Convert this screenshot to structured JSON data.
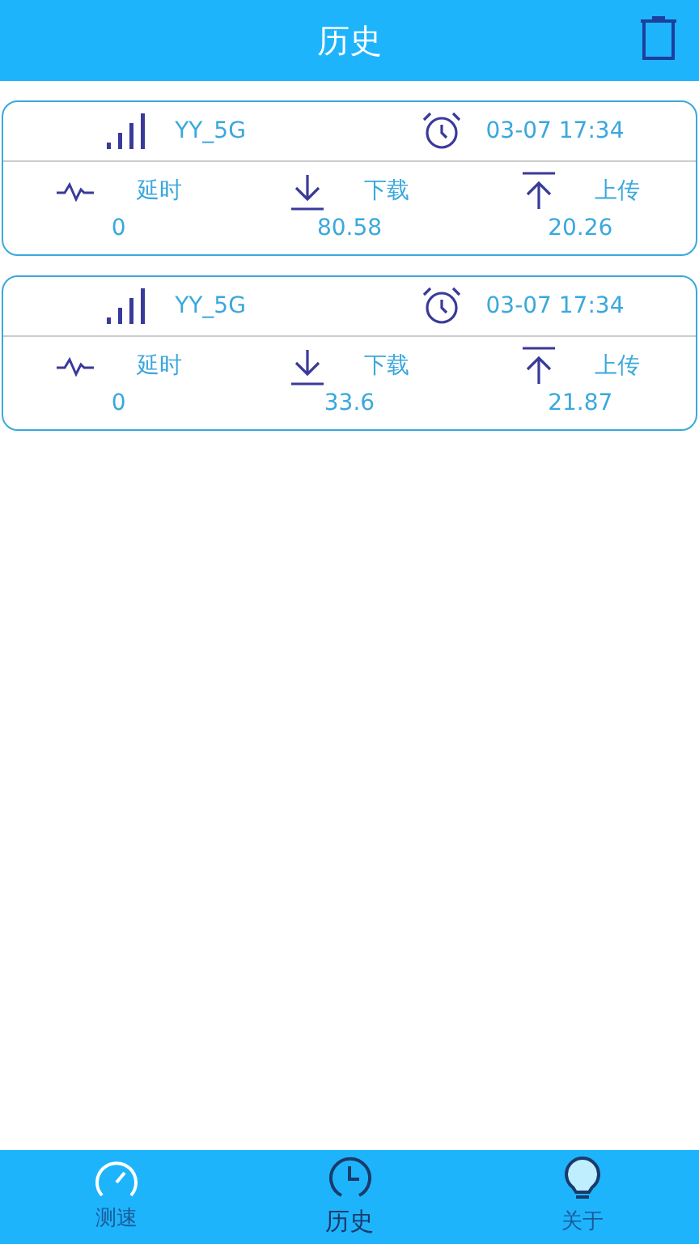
{
  "header": {
    "title": "历史"
  },
  "records": [
    {
      "network": "YY_5G",
      "time": "03-07 17:34",
      "stats": [
        {
          "kind": "latency",
          "label": "延时",
          "value": "0"
        },
        {
          "kind": "download",
          "label": "下载",
          "value": "80.58"
        },
        {
          "kind": "upload",
          "label": "上传",
          "value": "20.26"
        }
      ]
    },
    {
      "network": "YY_5G",
      "time": "03-07 17:34",
      "stats": [
        {
          "kind": "latency",
          "label": "延时",
          "value": "0"
        },
        {
          "kind": "download",
          "label": "下载",
          "value": "33.6"
        },
        {
          "kind": "upload",
          "label": "上传",
          "value": "21.87"
        }
      ]
    }
  ],
  "tabs": [
    {
      "kind": "speed",
      "label": "测速",
      "selected": false
    },
    {
      "kind": "history",
      "label": "历史",
      "selected": true
    },
    {
      "kind": "about",
      "label": "关于",
      "selected": false
    }
  ]
}
